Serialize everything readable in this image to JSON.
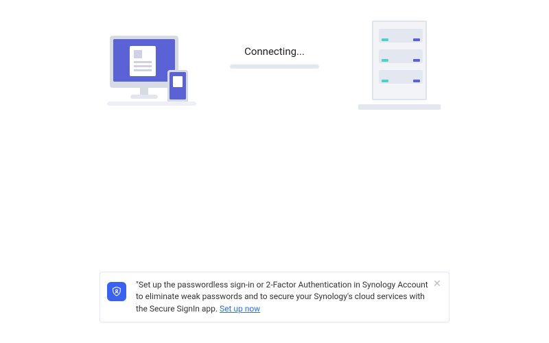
{
  "status": {
    "text": "Connecting..."
  },
  "tip": {
    "message": "\"Set up the passwordless sign-in or 2-Factor Authentication in Synology Account to eliminate weak passwords and to secure your Synology's cloud services with the Secure SignIn app. ",
    "link_label": "Set up now",
    "close_glyph": "✕"
  }
}
